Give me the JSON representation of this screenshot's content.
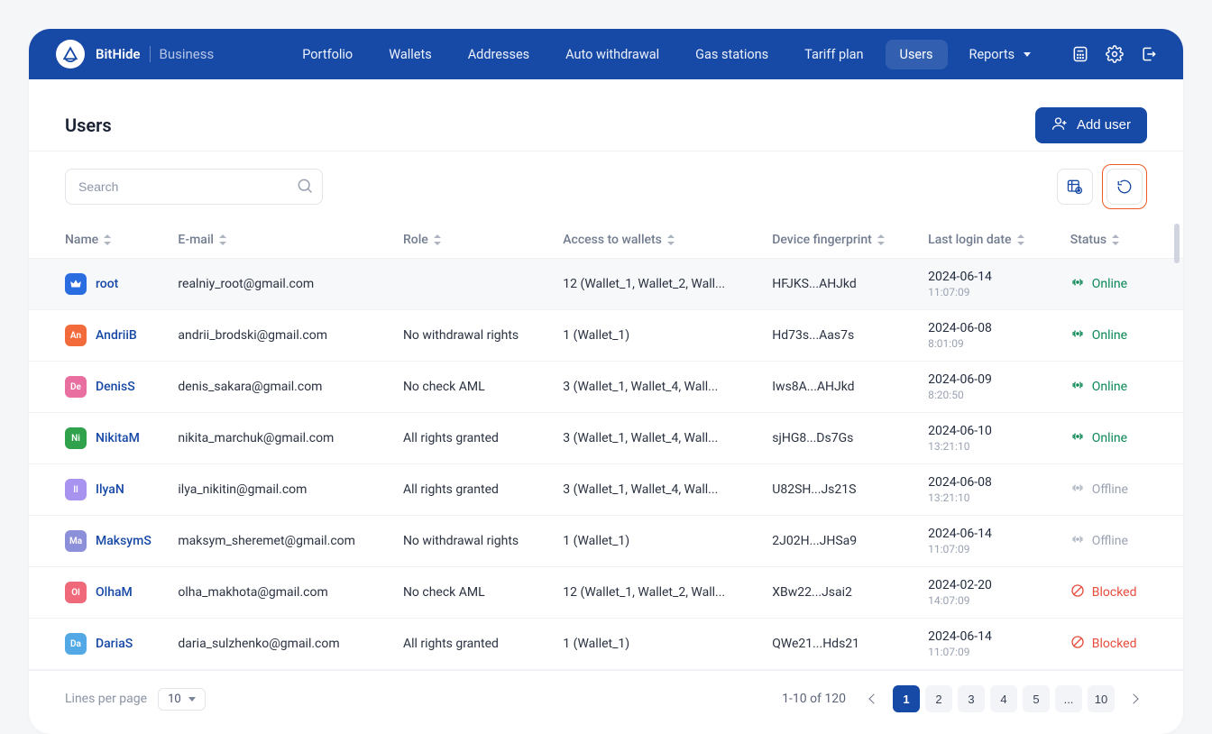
{
  "brand": {
    "name": "BitHide",
    "sub": "Business"
  },
  "nav": {
    "items": [
      {
        "label": "Portfolio",
        "active": false
      },
      {
        "label": "Wallets",
        "active": false
      },
      {
        "label": "Addresses",
        "active": false
      },
      {
        "label": "Auto withdrawal",
        "active": false
      },
      {
        "label": "Gas stations",
        "active": false
      },
      {
        "label": "Tariff plan",
        "active": false
      },
      {
        "label": "Users",
        "active": true
      },
      {
        "label": "Reports",
        "active": false,
        "hasCaret": true
      }
    ]
  },
  "header": {
    "title": "Users",
    "add_user_label": "Add user"
  },
  "toolbar": {
    "search_placeholder": "Search"
  },
  "table": {
    "columns": {
      "name": "Name",
      "email": "E-mail",
      "role": "Role",
      "access": "Access to wallets",
      "device": "Device fingerprint",
      "login": "Last login date",
      "status": "Status"
    },
    "rows": [
      {
        "avatar_bg": "#2a6de0",
        "avatar_text": "",
        "avatar_icon": "crown",
        "name": "root",
        "email": "realniy_root@gmail.com",
        "role": "",
        "access": "12 (Wallet_1, Wallet_2, Wall...",
        "device": "HFJKS...AHJkd",
        "login_date": "2024-06-14",
        "login_time": "11:07:09",
        "status": "Online"
      },
      {
        "avatar_bg": "#f46b3b",
        "avatar_text": "An",
        "name": "AndriiB",
        "email": "andrii_brodski@gmail.com",
        "role": "No withdrawal rights",
        "access": "1 (Wallet_1)",
        "device": "Hd73s...Aas7s",
        "login_date": "2024-06-08",
        "login_time": "8:01:09",
        "status": "Online"
      },
      {
        "avatar_bg": "#e96fa0",
        "avatar_text": "De",
        "name": "DenisS",
        "email": "denis_sakara@gmail.com",
        "role": "No check AML",
        "access": "3 (Wallet_1, Wallet_4, Wall...",
        "device": "Iws8A...AHJkd",
        "login_date": "2024-06-09",
        "login_time": "8:20:50",
        "status": "Online"
      },
      {
        "avatar_bg": "#30a24c",
        "avatar_text": "Ni",
        "name": "NikitaM",
        "email": "nikita_marchuk@gmail.com",
        "role": "All rights granted",
        "access": "3 (Wallet_1, Wallet_4, Wall...",
        "device": "sjHG8...Ds7Gs",
        "login_date": "2024-06-10",
        "login_time": "13:21:10",
        "status": "Online"
      },
      {
        "avatar_bg": "#a993f0",
        "avatar_text": "Il",
        "name": "IlyaN",
        "email": "ilya_nikitin@gmail.com",
        "role": "All rights granted",
        "access": "3 (Wallet_1, Wallet_4, Wall...",
        "device": "U82SH...Js21S",
        "login_date": "2024-06-08",
        "login_time": "13:21:10",
        "status": "Offline"
      },
      {
        "avatar_bg": "#8c8fd9",
        "avatar_text": "Ma",
        "name": "MaksymS",
        "email": "maksym_sheremet@gmail.com",
        "role": "No withdrawal rights",
        "access": "1 (Wallet_1)",
        "device": "2J02H...JHSa9",
        "login_date": "2024-06-14",
        "login_time": "11:07:09",
        "status": "Offline"
      },
      {
        "avatar_bg": "#f0697a",
        "avatar_text": "Ol",
        "name": "OlhaM",
        "email": "olha_makhota@gmail.com",
        "role": "No check AML",
        "access": "12 (Wallet_1, Wallet_2, Wall...",
        "device": "XBw22...Jsai2",
        "login_date": "2024-02-20",
        "login_time": "14:07:09",
        "status": "Blocked"
      },
      {
        "avatar_bg": "#52a9e6",
        "avatar_text": "Da",
        "name": "DariaS",
        "email": "daria_sulzhenko@gmail.com",
        "role": "All rights granted",
        "access": "1 (Wallet_1)",
        "device": "QWe21...Hds21",
        "login_date": "2024-06-14",
        "login_time": "11:07:09",
        "status": "Blocked"
      }
    ]
  },
  "footer": {
    "lpp_label": "Lines per page",
    "lpp_value": "10",
    "summary": "1-10 of 120",
    "pages": [
      "1",
      "2",
      "3",
      "4",
      "5",
      "...",
      "10"
    ],
    "active_page": "1"
  }
}
